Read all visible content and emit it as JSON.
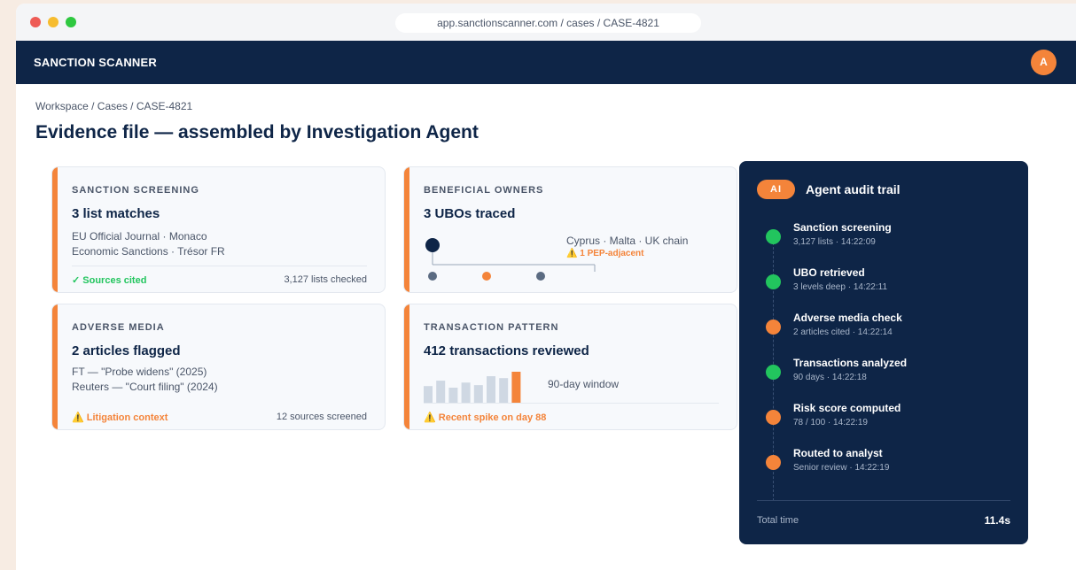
{
  "browser": {
    "url": "app.sanctionscanner.com / cases / CASE-4821"
  },
  "app": {
    "brand": "SANCTION SCANNER",
    "avatar_initial": "A"
  },
  "breadcrumb": "Workspace / Cases / CASE-4821",
  "page_title": "Evidence file — assembled by Investigation Agent",
  "cards": {
    "sanction": {
      "label": "SANCTION SCREENING",
      "headline": "3 list matches",
      "lines": [
        "EU Official Journal · Monaco",
        "Economic Sanctions · Trésor FR"
      ],
      "footer_left": "✓ Sources cited",
      "footer_right": "3,127 lists checked"
    },
    "owners": {
      "label": "BENEFICIAL OWNERS",
      "headline": "3 UBOs traced",
      "chain": "Cyprus · Malta · UK chain",
      "pep": "⚠️ 1 PEP-adjacent"
    },
    "media": {
      "label": "ADVERSE MEDIA",
      "headline": "2 articles flagged",
      "lines": [
        "FT — \"Probe widens\" (2025)",
        "Reuters — \"Court filing\" (2024)"
      ],
      "footer_left": "⚠️ Litigation context",
      "footer_right": "12 sources screened"
    },
    "transactions": {
      "label": "TRANSACTION PATTERN",
      "headline": "412 transactions reviewed",
      "window": "90-day window",
      "footer_left": "⚠️ Recent spike on day 88",
      "bars": [
        0.55,
        0.72,
        0.5,
        0.66,
        0.58,
        0.86,
        0.8,
        1.0
      ]
    }
  },
  "audit": {
    "badge": "AI",
    "title": "Agent audit trail",
    "steps": [
      {
        "title": "Sanction screening",
        "sub": "3,127 lists · 14:22:09",
        "status": "green"
      },
      {
        "title": "UBO retrieved",
        "sub": "3 levels deep · 14:22:11",
        "status": "green"
      },
      {
        "title": "Adverse media check",
        "sub": "2 articles cited · 14:22:14",
        "status": "orange"
      },
      {
        "title": "Transactions analyzed",
        "sub": "90 days · 14:22:18",
        "status": "green"
      },
      {
        "title": "Risk score computed",
        "sub": "78 / 100 · 14:22:19",
        "status": "orange"
      },
      {
        "title": "Routed to analyst",
        "sub": "Senior review · 14:22:19",
        "status": "orange"
      }
    ],
    "total_label": "Total time",
    "total_value": "11.4s"
  },
  "colors": {
    "navy": "#0e2547",
    "accent": "#f4843a",
    "success": "#22c55e",
    "node_gray": "#5b6b82",
    "bar_gray": "#cfd8e3"
  }
}
